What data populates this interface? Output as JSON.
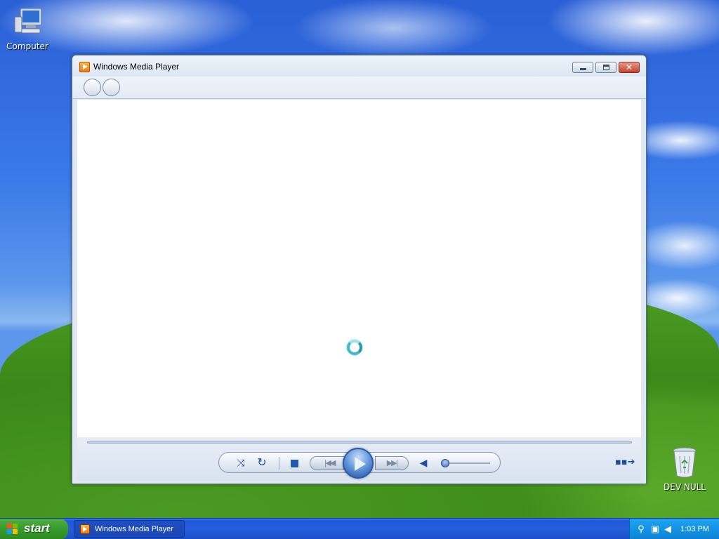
{
  "desktop": {
    "icons": [
      {
        "name": "computer",
        "label": "Computer"
      },
      {
        "name": "recycle-bin",
        "label": "DEV NULL"
      }
    ]
  },
  "window": {
    "title": "Windows Media Player",
    "buttons": {
      "minimize": "minimize",
      "maximize": "maximize",
      "close": "✕"
    }
  },
  "player": {
    "state": "loading",
    "volume_fraction": 0.0
  },
  "taskbar": {
    "start_label": "start",
    "tasks": [
      {
        "label": "Windows Media Player",
        "icon": "media-player-icon"
      }
    ],
    "tray": {
      "clock": "1:03 PM"
    }
  },
  "colors": {
    "taskbar_blue": "#245edb",
    "start_green": "#379b2c",
    "tray_blue": "#1290e1",
    "accent_blue": "#1f4f9a"
  }
}
